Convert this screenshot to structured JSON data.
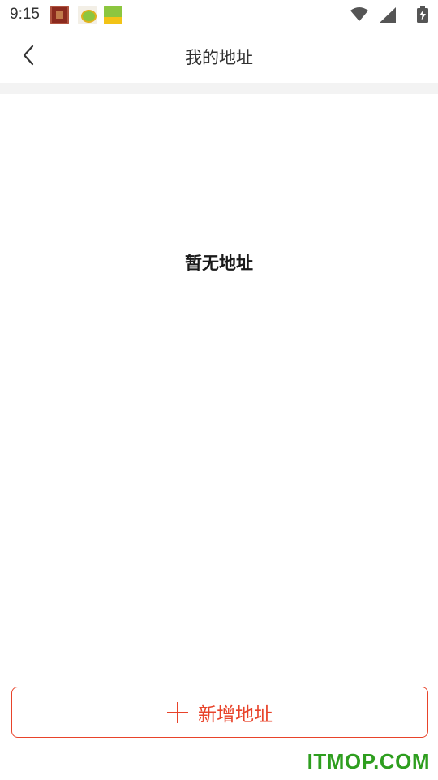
{
  "status_bar": {
    "time": "9:15",
    "notification_icons": [
      "app-notification-icon",
      "app-notification-icon",
      "app-notification-icon"
    ],
    "system_icons": [
      "wifi-icon",
      "signal-icon",
      "battery-charging-icon"
    ]
  },
  "nav": {
    "back_icon": "chevron-left-icon",
    "title": "我的地址"
  },
  "main": {
    "empty_message": "暂无地址"
  },
  "footer": {
    "add_button_label": "新增地址",
    "add_icon": "plus-icon"
  },
  "watermark": "ITMOP.COM",
  "colors": {
    "accent": "#e8432a",
    "divider": "#f3f3f3",
    "watermark": "#2e9e1f"
  }
}
